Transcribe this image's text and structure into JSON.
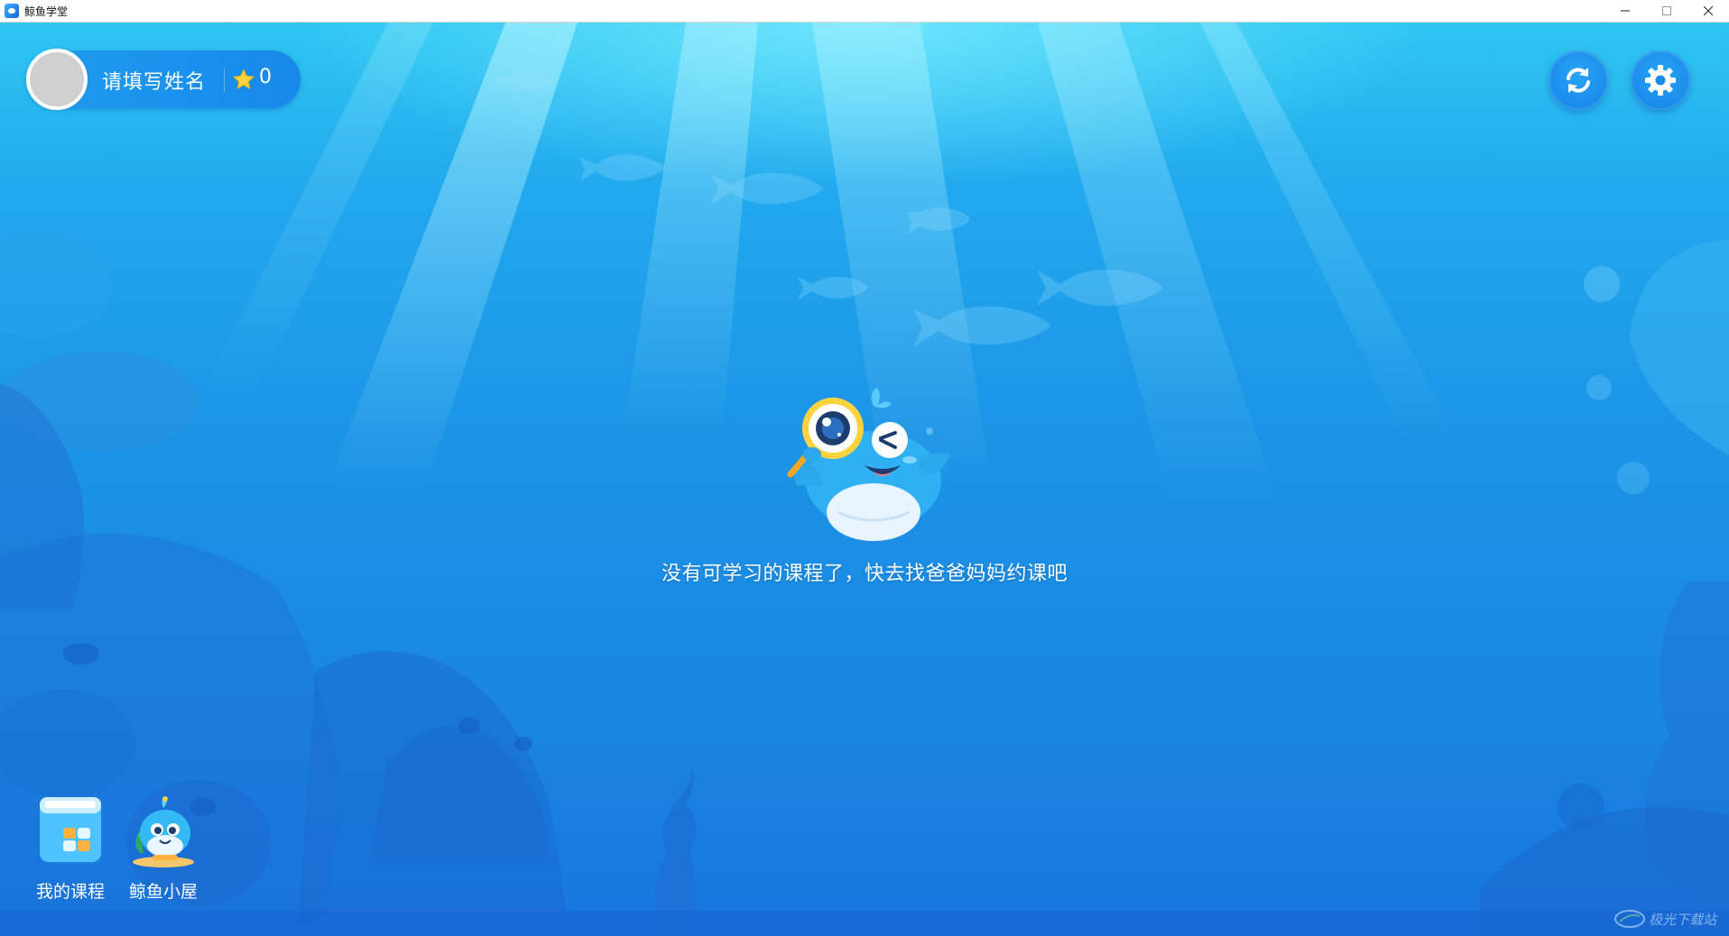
{
  "window": {
    "title": "鲸鱼学堂",
    "minimize_glyph": "─",
    "maximize_glyph": "□",
    "close_glyph": "✕"
  },
  "profile": {
    "name_placeholder": "请填写姓名",
    "stars": "0",
    "star_icon": "star-icon"
  },
  "toolbar": {
    "refresh_icon": "refresh-icon",
    "settings_icon": "gear-icon"
  },
  "empty_state": {
    "message": "没有可学习的课程了，快去找爸爸妈妈约课吧",
    "illustration": "whale-magnifier-mascot"
  },
  "nav": {
    "items": [
      {
        "label": "我的课程",
        "icon": "course-book-icon"
      },
      {
        "label": "鲸鱼小屋",
        "icon": "whale-house-icon"
      }
    ]
  },
  "watermark": {
    "text": "极光下载站"
  },
  "colors": {
    "sky_top": "#2fc6f2",
    "sea_bottom": "#1876de",
    "accent_yellow": "#ffd23f",
    "pill_blue": "#1e9cf0"
  }
}
